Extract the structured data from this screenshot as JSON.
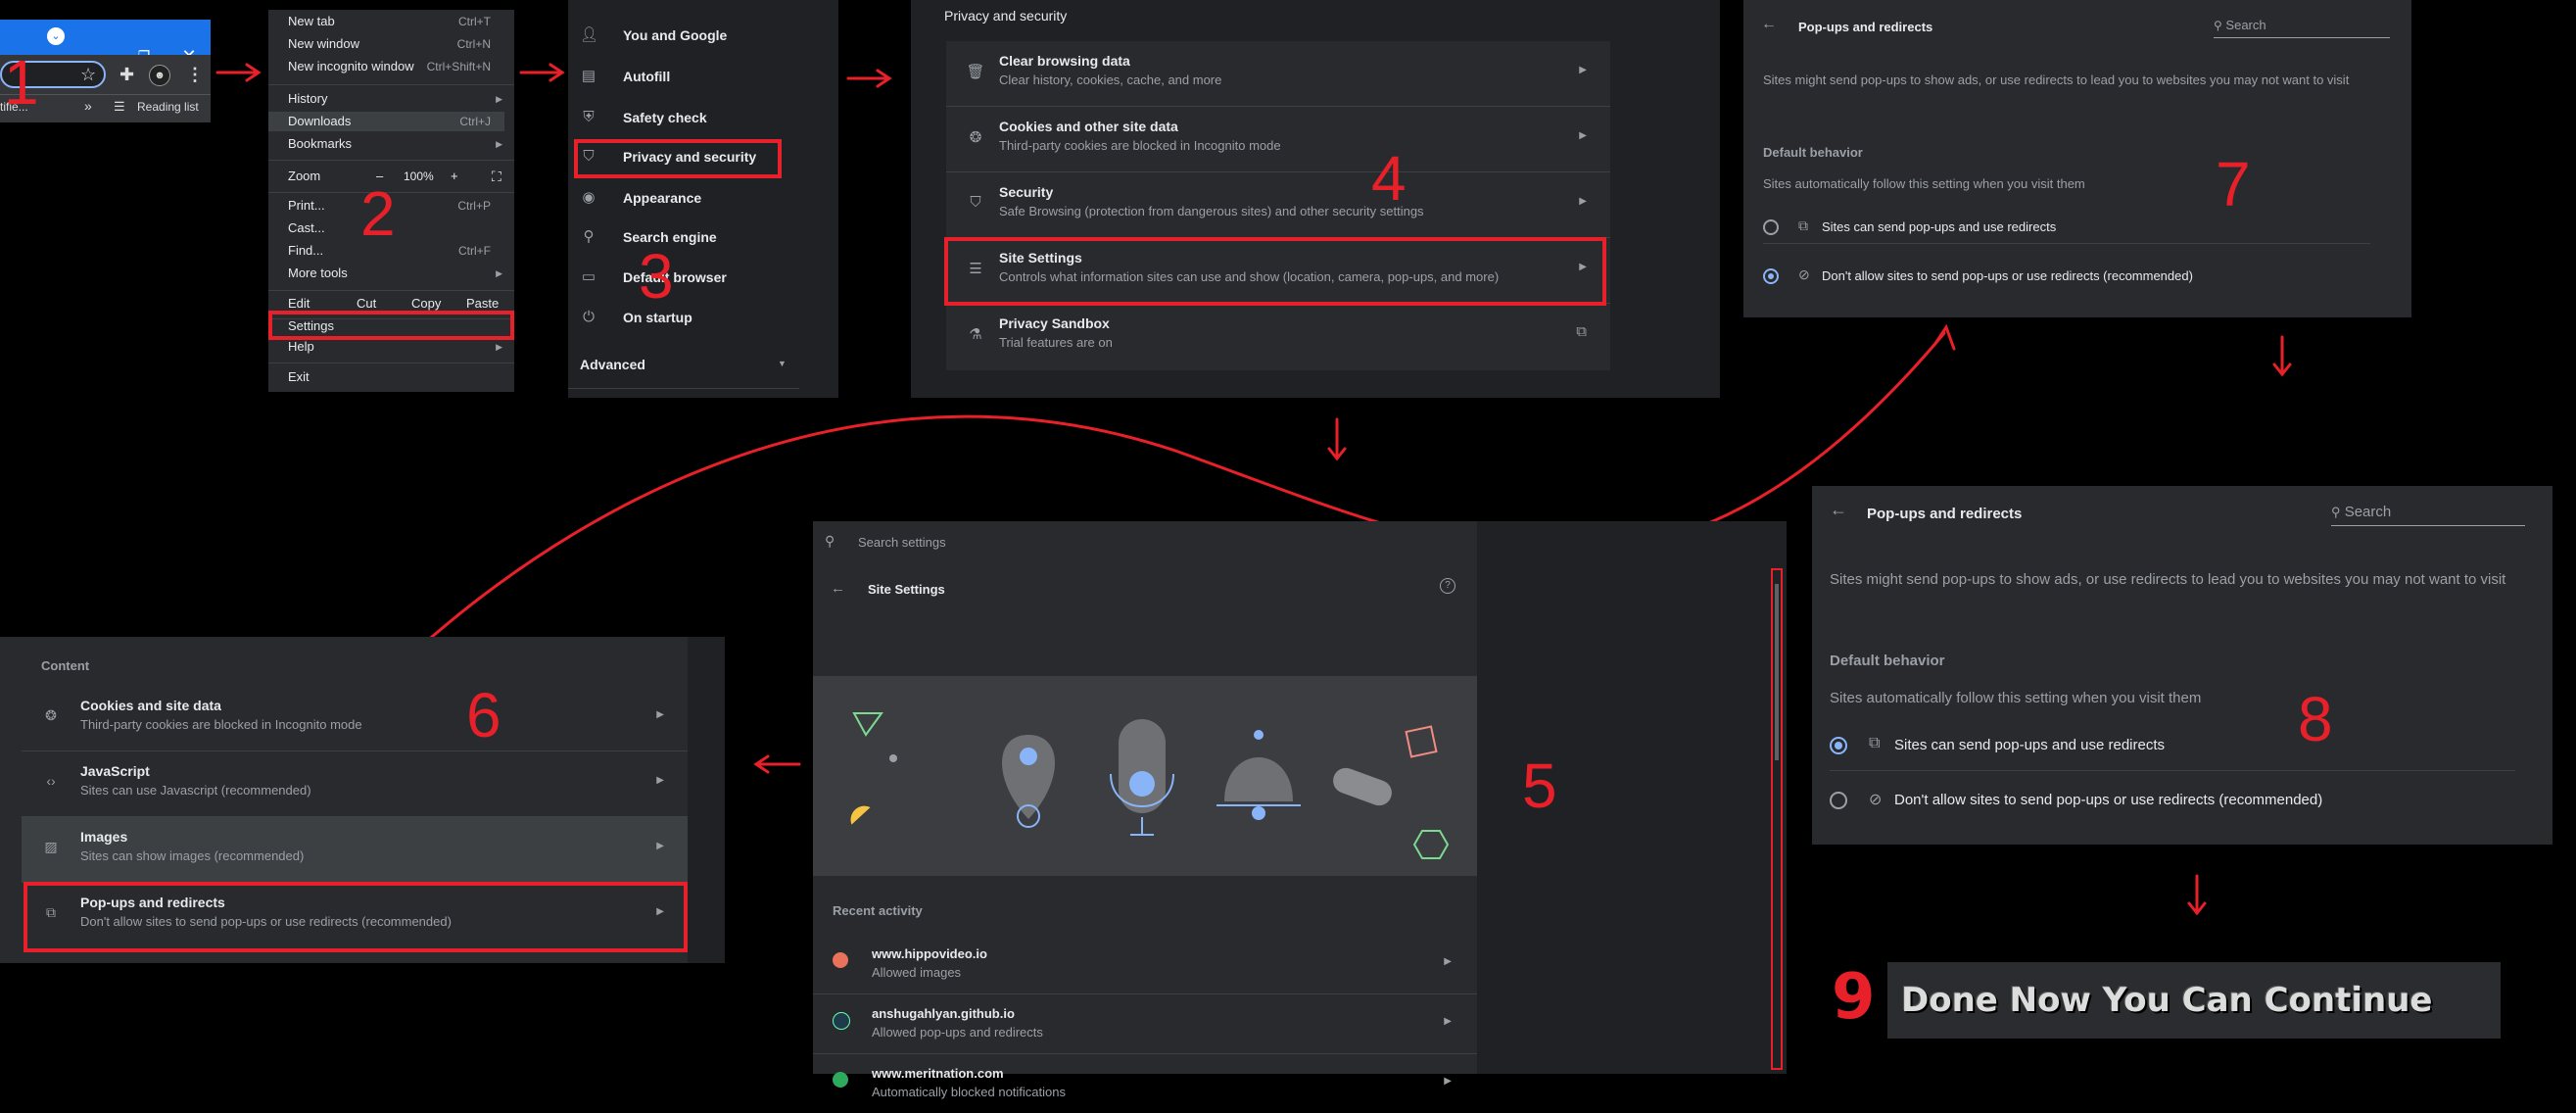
{
  "steps": [
    "1",
    "2",
    "3",
    "4",
    "5",
    "6",
    "7",
    "8",
    "9"
  ],
  "chrome": {
    "bookmark_partial": "tifie...",
    "more_bookmarks": "»",
    "reading_list": "Reading list"
  },
  "menu": {
    "new_tab": "New tab",
    "new_tab_sc": "Ctrl+T",
    "new_window": "New window",
    "new_window_sc": "Ctrl+N",
    "new_incognito": "New incognito window",
    "new_incognito_sc": "Ctrl+Shift+N",
    "history": "History",
    "downloads": "Downloads",
    "downloads_sc": "Ctrl+J",
    "bookmarks": "Bookmarks",
    "zoom": "Zoom",
    "zoom_minus": "–",
    "zoom_value": "100%",
    "zoom_plus": "+",
    "print": "Print...",
    "print_sc": "Ctrl+P",
    "cast": "Cast...",
    "find": "Find...",
    "find_sc": "Ctrl+F",
    "more_tools": "More tools",
    "edit": "Edit",
    "cut": "Cut",
    "copy": "Copy",
    "paste": "Paste",
    "settings": "Settings",
    "help": "Help",
    "exit": "Exit"
  },
  "sidebar": {
    "items": [
      "You and Google",
      "Autofill",
      "Safety check",
      "Privacy and security",
      "Appearance",
      "Search engine",
      "Default browser",
      "On startup"
    ],
    "advanced": "Advanced"
  },
  "privacy": {
    "header": "Privacy and security",
    "rows": [
      {
        "title": "Clear browsing data",
        "desc": "Clear history, cookies, cache, and more"
      },
      {
        "title": "Cookies and other site data",
        "desc": "Third-party cookies are blocked in Incognito mode"
      },
      {
        "title": "Security",
        "desc": "Safe Browsing (protection from dangerous sites) and other security settings"
      },
      {
        "title": "Site Settings",
        "desc": "Controls what information sites can use and show (location, camera, pop-ups, and more)"
      },
      {
        "title": "Privacy Sandbox",
        "desc": "Trial features are on"
      }
    ]
  },
  "popups7": {
    "title": "Pop-ups and redirects",
    "search_placeholder": "Search",
    "desc": "Sites might send pop-ups to show ads, or use redirects to lead you to websites you may not want to visit",
    "default_behavior": "Default behavior",
    "follow": "Sites automatically follow this setting when you visit them",
    "option_allow": "Sites can send pop-ups and use redirects",
    "option_block": "Don't allow sites to send pop-ups or use redirects (recommended)",
    "selected": "block"
  },
  "popups8": {
    "title": "Pop-ups and redirects",
    "search_placeholder": "Search",
    "desc": "Sites might send pop-ups to show ads, or use redirects to lead you to websites you may not want to visit",
    "default_behavior": "Default behavior",
    "follow": "Sites automatically follow this setting when you visit them",
    "option_allow": "Sites can send pop-ups and use redirects",
    "option_block": "Don't allow sites to send pop-ups or use redirects (recommended)",
    "selected": "allow"
  },
  "site_settings": {
    "search_placeholder": "Search settings",
    "title": "Site Settings",
    "recent_activity": "Recent activity",
    "recent": [
      {
        "site": "www.hippovideo.io",
        "detail": "Allowed images",
        "color": "#e8735a"
      },
      {
        "site": "anshugahlyan.github.io",
        "detail": "Allowed pop-ups and redirects",
        "color": "#1f3a4a"
      },
      {
        "site": "www.meritnation.com",
        "detail": "Automatically blocked notifications",
        "color": "#2eaa5c"
      }
    ]
  },
  "content": {
    "header": "Content",
    "rows": [
      {
        "title": "Cookies and site data",
        "desc": "Third-party cookies are blocked in Incognito mode"
      },
      {
        "title": "JavaScript",
        "desc": "Sites can use Javascript (recommended)"
      },
      {
        "title": "Images",
        "desc": "Sites can show images (recommended)"
      },
      {
        "title": "Pop-ups and redirects",
        "desc": "Don't allow sites to send pop-ups or use redirects (recommended)"
      }
    ]
  },
  "done_text": "Done Now You Can Continue",
  "colors": {
    "annotation": "#e8202a",
    "accent": "#8ab4f8",
    "chrome_titlebar": "#1a73e8"
  }
}
